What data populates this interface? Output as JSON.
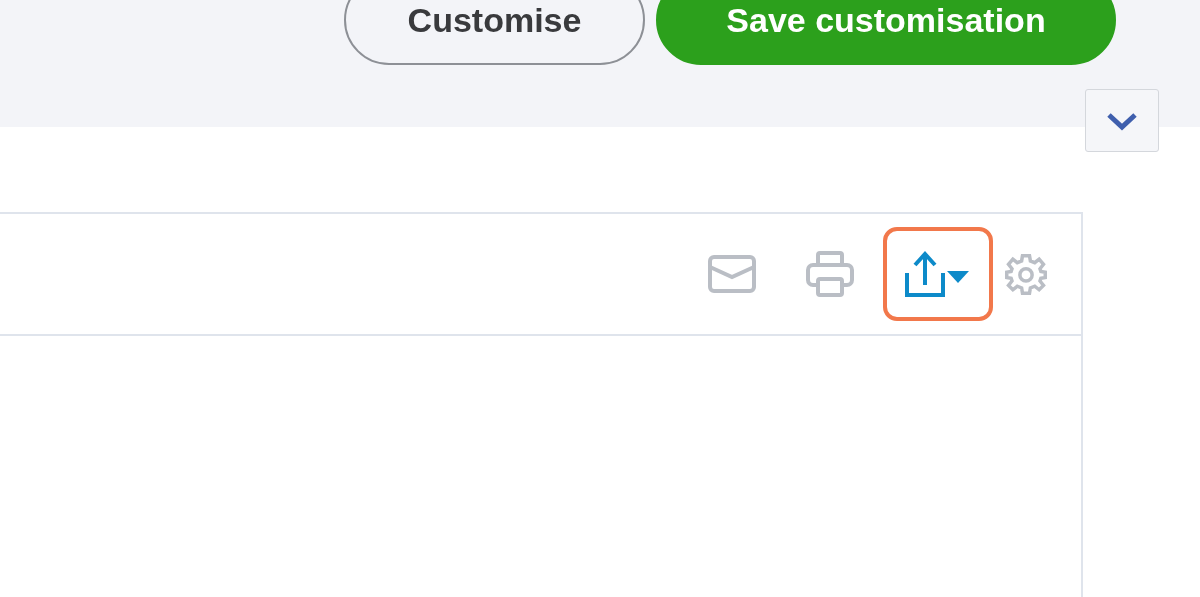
{
  "header": {
    "buttons": [
      {
        "label": "Customise",
        "kind": "secondary"
      },
      {
        "label": "Save customisation",
        "kind": "primary"
      }
    ]
  },
  "report": {
    "tools": [
      {
        "kind": "mail",
        "highlighted": false
      },
      {
        "kind": "print",
        "highlighted": false
      },
      {
        "kind": "export",
        "highlighted": true
      },
      {
        "kind": "settings",
        "highlighted": false
      }
    ]
  }
}
